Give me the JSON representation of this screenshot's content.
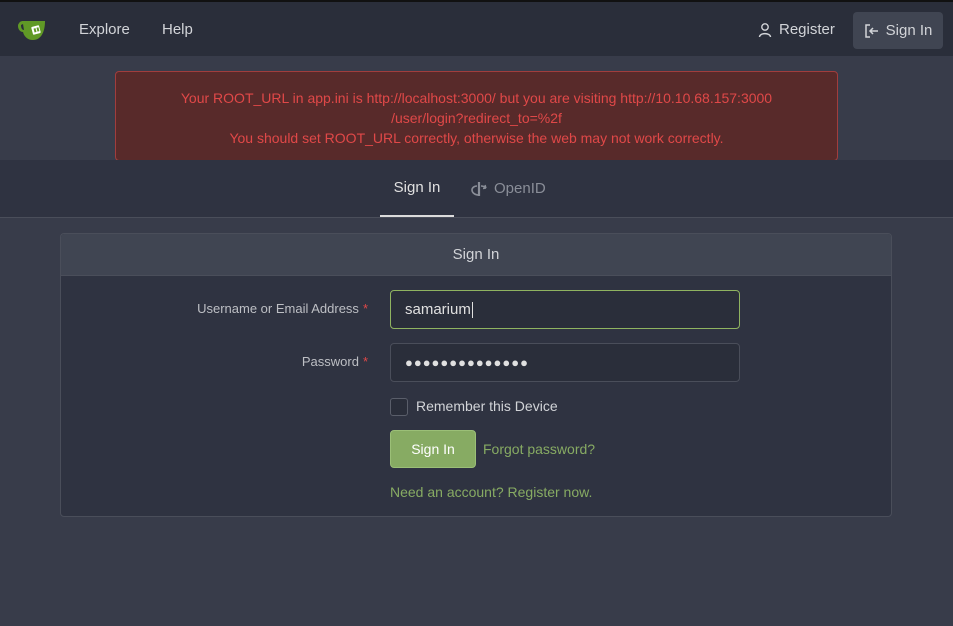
{
  "nav": {
    "explore": "Explore",
    "help": "Help",
    "register": "Register",
    "sign_in": "Sign In"
  },
  "alert": {
    "line1": "Your ROOT_URL in app.ini is http://localhost:3000/ but you are visiting http://10.10.68.157:3000",
    "line2": "/user/login?redirect_to=%2f",
    "line3": "You should set ROOT_URL correctly, otherwise the web may not work correctly."
  },
  "tabs": {
    "sign_in": "Sign In",
    "openid": "OpenID"
  },
  "form": {
    "header": "Sign In",
    "username_label": "Username or Email Address",
    "username_value": "samarium",
    "password_label": "Password",
    "password_mask": "●●●●●●●●●●●●●●",
    "required_marker": "*",
    "remember_label": "Remember this Device",
    "submit_label": "Sign In",
    "forgot_label": "Forgot password?",
    "need_account": "Need an account? Register now."
  },
  "colors": {
    "accent_green": "#87ab63",
    "error_red": "#e04848"
  }
}
